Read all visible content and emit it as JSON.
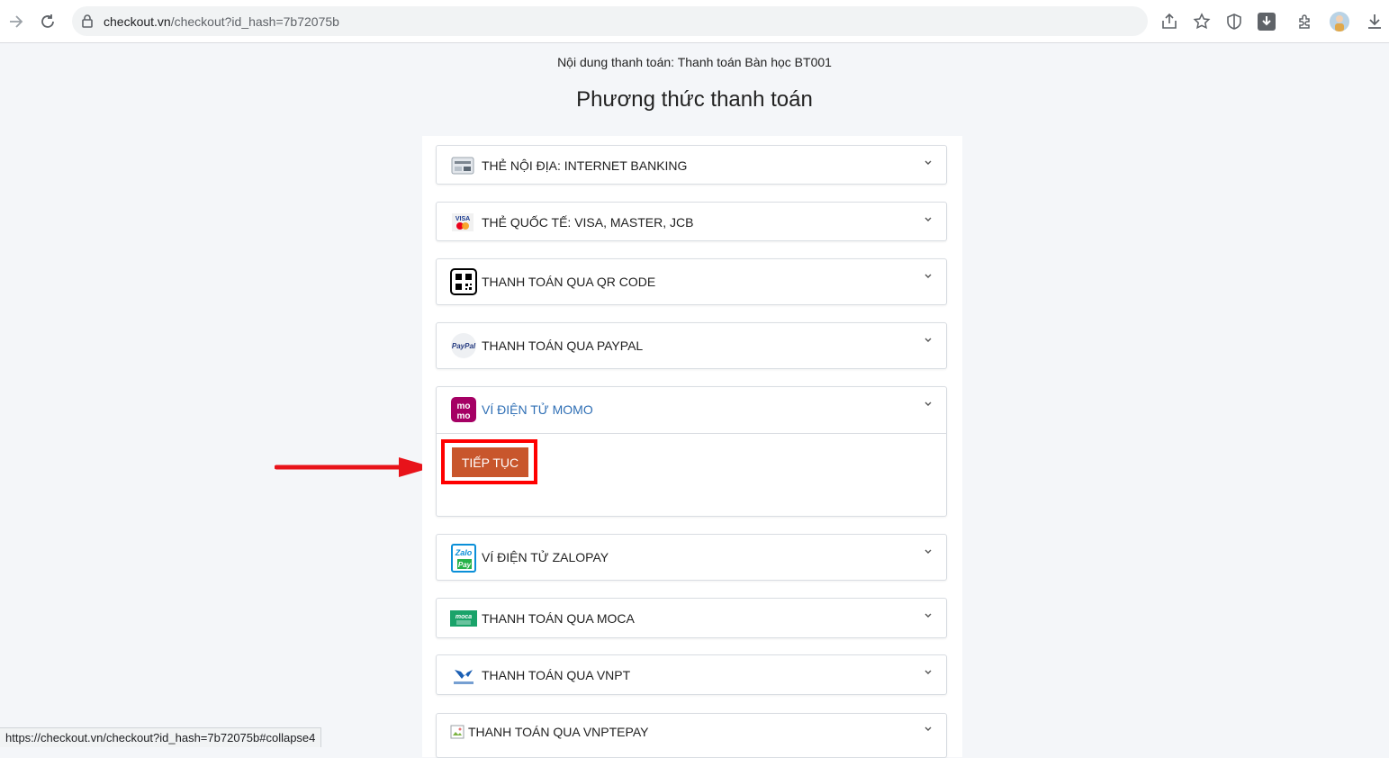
{
  "browser": {
    "url_host": "checkout.vn",
    "url_path": "/checkout?id_hash=7b72075b",
    "status_url": "https://checkout.vn/checkout?id_hash=7b72075b#collapse4"
  },
  "page": {
    "description": "Nội dung thanh toán: Thanh toán Bàn học BT001",
    "title": "Phương thức thanh toán"
  },
  "payment_methods": [
    {
      "label": "THẺ NỘI ĐỊA: INTERNET BANKING",
      "icon": "bank-card-icon"
    },
    {
      "label": "THẺ QUỐC TẾ: VISA, MASTER, JCB",
      "icon": "visa-master-icon"
    },
    {
      "label": "THANH TOÁN QUA QR CODE",
      "icon": "qr-code-icon"
    },
    {
      "label": "THANH TOÁN QUA PAYPAL",
      "icon": "paypal-icon"
    },
    {
      "label": "VÍ ĐIỆN TỬ MOMO",
      "icon": "momo-icon",
      "expanded": true
    },
    {
      "label": "VÍ ĐIỆN TỬ ZALOPAY",
      "icon": "zalopay-icon"
    },
    {
      "label": "THANH TOÁN QUA MOCA",
      "icon": "moca-icon"
    },
    {
      "label": "THANH TOÁN QUA VNPT",
      "icon": "vnpt-icon"
    },
    {
      "label": "THANH TOÁN QUA VNPTEPAY",
      "icon": "broken-image-icon"
    }
  ],
  "continue_button": "TIẾP TỤC",
  "colors": {
    "accent_link": "#2f6fb5",
    "button": "#c8562c",
    "highlight": "#ff0000"
  }
}
